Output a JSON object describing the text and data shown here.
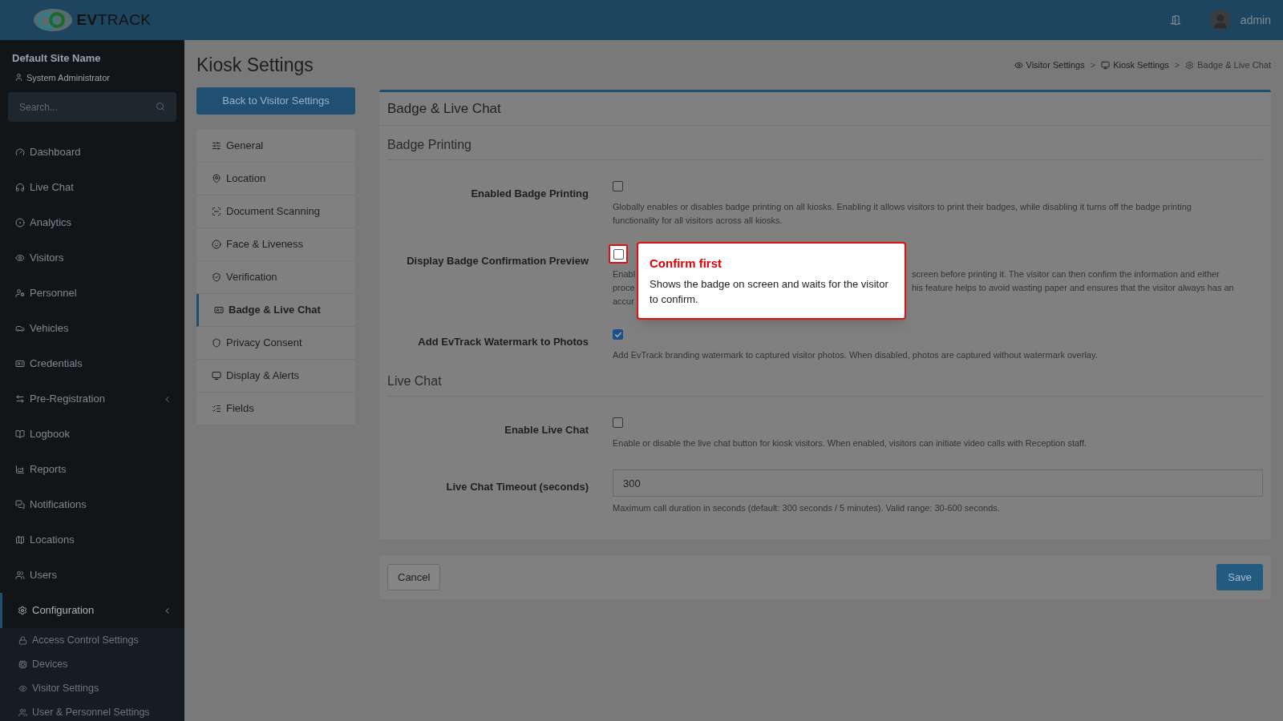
{
  "header": {
    "logo_text": "**EV**TRACK",
    "user": "admin"
  },
  "sidebar": {
    "site_name": "Default Site Name",
    "role": "System Administrator",
    "search": {
      "placeholder": "Search..."
    },
    "items": [
      {
        "label": "Dashboard",
        "selected": false,
        "expandable": false
      },
      {
        "label": "Live Chat",
        "selected": false,
        "expandable": false
      },
      {
        "label": "Analytics",
        "selected": false,
        "expandable": false
      },
      {
        "label": "Visitors",
        "selected": false,
        "expandable": false
      },
      {
        "label": "Personnel",
        "selected": false,
        "expandable": false
      },
      {
        "label": "Vehicles",
        "selected": false,
        "expandable": false
      },
      {
        "label": "Credentials",
        "selected": false,
        "expandable": false
      },
      {
        "label": "Pre-Registration",
        "selected": false,
        "expandable": true
      },
      {
        "label": "Logbook",
        "selected": false,
        "expandable": false
      },
      {
        "label": "Reports",
        "selected": false,
        "expandable": false
      },
      {
        "label": "Notifications",
        "selected": false,
        "expandable": false
      },
      {
        "label": "Locations",
        "selected": false,
        "expandable": false
      },
      {
        "label": "Users",
        "selected": false,
        "expandable": false
      },
      {
        "label": "Configuration",
        "selected": true,
        "expandable": true,
        "children": [
          {
            "label": "Access Control Settings"
          },
          {
            "label": "Devices"
          },
          {
            "label": "Visitor Settings"
          },
          {
            "label": "User & Personnel Settings"
          }
        ]
      }
    ]
  },
  "page": {
    "title": "Kiosk Settings",
    "back_button": "Back to Visitor Settings",
    "breadcrumb": {
      "separator": ">",
      "items": [
        {
          "label": "Visitor Settings"
        },
        {
          "label": "Kiosk Settings"
        },
        {
          "label": "Badge & Live Chat"
        }
      ]
    },
    "nav": [
      {
        "label": "General",
        "selected": false
      },
      {
        "label": "Location",
        "selected": false
      },
      {
        "label": "Document Scanning",
        "selected": false
      },
      {
        "label": "Face & Liveness",
        "selected": false
      },
      {
        "label": "Verification",
        "selected": false
      },
      {
        "label": "Badge & Live Chat",
        "selected": true
      },
      {
        "label": "Privacy Consent",
        "selected": false
      },
      {
        "label": "Display & Alerts",
        "selected": false
      },
      {
        "label": "Fields",
        "selected": false
      }
    ],
    "card_title": "Badge & Live Chat",
    "sections": [
      {
        "title": "Badge Printing",
        "fields": [
          {
            "kind": "checkbox",
            "label": "Enabled Badge Printing",
            "checked": false,
            "highlighted": false,
            "description": "Globally enables or disables badge printing on all kiosks. Enabling it allows visitors to print their badges, while disabling it turns off the badge printing functionality for all visitors across all kiosks."
          },
          {
            "kind": "checkbox",
            "label": "Display Badge Confirmation Preview",
            "checked": false,
            "highlighted": true,
            "description_lines": [
              {
                "start": "Enabl",
                "end": "screen before printing it. The visitor can then confirm the information and either"
              },
              {
                "start": "proce",
                "end": "his feature helps to avoid wasting paper and ensures that the visitor always has an"
              },
              {
                "start": "accur"
              }
            ]
          },
          {
            "kind": "checkbox",
            "label": "Add EvTrack Watermark to Photos",
            "checked": true,
            "highlighted": false,
            "description": "Add EvTrack branding watermark to captured visitor photos. When disabled, photos are captured without watermark overlay."
          }
        ]
      },
      {
        "title": "Live Chat",
        "fields": [
          {
            "kind": "checkbox",
            "label": "Enable Live Chat",
            "checked": false,
            "highlighted": false,
            "description": "Enable or disable the live chat button for kiosk visitors. When enabled, visitors can initiate video calls with Reception staff."
          },
          {
            "kind": "number",
            "label": "Live Chat Timeout (seconds)",
            "value": "300",
            "description": "Maximum call duration in seconds (default: 300 seconds / 5 minutes). Valid range: 30-600 seconds."
          }
        ]
      }
    ],
    "cancel": "Cancel",
    "save": "Save"
  },
  "tour": {
    "title": "Confirm first",
    "text": "Shows the badge on screen and waits for the visitor to confirm."
  }
}
